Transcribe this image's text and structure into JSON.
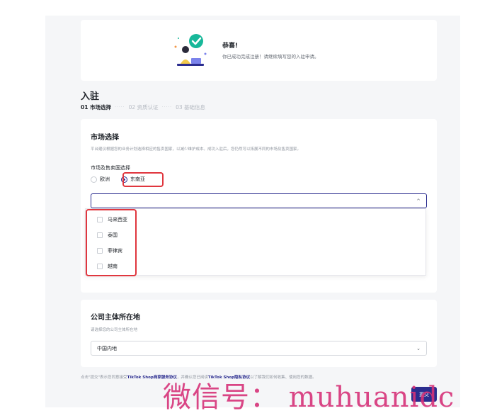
{
  "congrats": {
    "title": "恭喜!",
    "subtitle": "你已成功完成注册！请继续填写您的入驻申请。"
  },
  "page": {
    "heading": "入驻"
  },
  "steps": [
    {
      "label": "01 市场选择",
      "active": true
    },
    {
      "label": "02 资质认证",
      "active": false
    },
    {
      "label": "03 基础信息",
      "active": false
    }
  ],
  "steps_separator": "·····",
  "market": {
    "title": "市场选择",
    "desc": "平台建议根据您的业务计划选择相应的售卖国家，以减少维护成本。成功入驻后，您仍然可以拓展不同的市场及售卖国家。",
    "field_label": "市场及售卖国选择",
    "radios": [
      {
        "label": "欧洲",
        "selected": false
      },
      {
        "label": "东南亚",
        "selected": true
      }
    ],
    "select_value": "",
    "chevron_up": "^",
    "options": [
      "马来西亚",
      "泰国",
      "菲律宾",
      "越南"
    ]
  },
  "company": {
    "title": "公司主体所在地",
    "desc": "请选择您的公司主体所在地",
    "select_value": "中国内地",
    "chevron_down": "⌄"
  },
  "agreement": {
    "prefix": "点击\"提交\"表示您同意接受",
    "link1": "TikTok Shop商家服务协议",
    "middle": "，并确认您已阅读",
    "link2": "TikTok Shop隐私协议",
    "suffix": "以了解我们如何收集、使用您的数据。"
  },
  "submit_label": "提交",
  "watermark": "微信号： muhuanidc",
  "colors": {
    "accent": "#2b2d8f",
    "highlight": "#e0363e",
    "success": "#18b89a",
    "background": "#f5f6f8"
  }
}
